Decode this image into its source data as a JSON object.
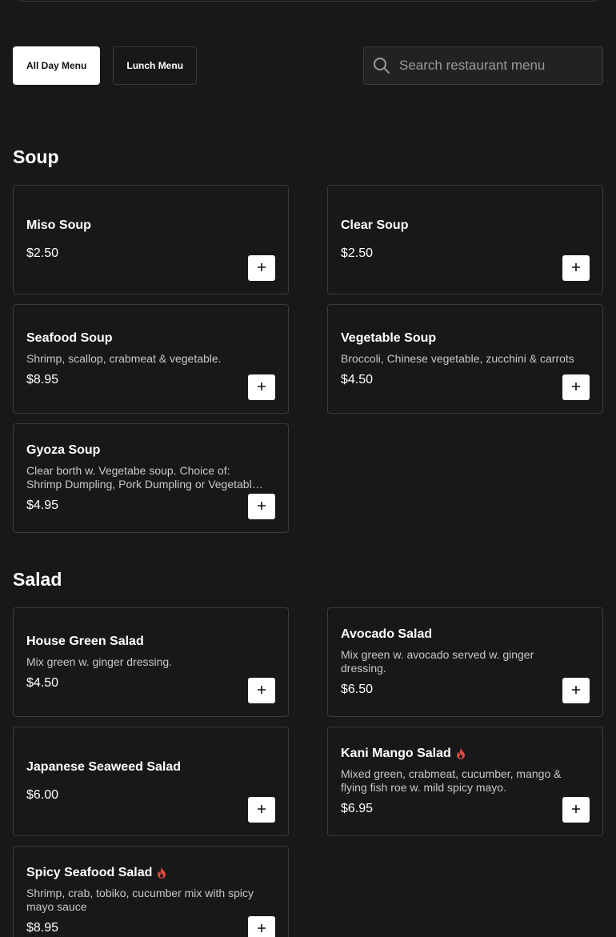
{
  "tabs": [
    {
      "label": "All Day Menu",
      "active": true
    },
    {
      "label": "Lunch Menu",
      "active": false
    }
  ],
  "search": {
    "placeholder": "Search restaurant menu",
    "value": ""
  },
  "colors": {
    "background": "#181818",
    "card_border": "#3a3a3a",
    "spicy": "#e04a3f",
    "button": "#ffffff"
  },
  "sections": [
    {
      "title": "Soup",
      "items": [
        {
          "name": "Miso Soup",
          "description": "",
          "price": "$2.50",
          "spicy": false
        },
        {
          "name": "Clear Soup",
          "description": "",
          "price": "$2.50",
          "spicy": false
        },
        {
          "name": "Seafood Soup",
          "description": "Shrimp, scallop, crabmeat & vegetable.",
          "price": "$8.95",
          "spicy": false
        },
        {
          "name": "Vegetable Soup",
          "description": "Broccoli, Chinese vegetable, zucchini & carrots",
          "price": "$4.50",
          "spicy": false
        },
        {
          "name": "Gyoza Soup",
          "description": "Clear borth w. Vegetabe soup. Choice of: Shrimp Dumpling, Pork Dumpling or Vegetable Dumpling",
          "price": "$4.95",
          "spicy": false
        }
      ]
    },
    {
      "title": "Salad",
      "items": [
        {
          "name": "House Green Salad",
          "description": "Mix green w. ginger dressing.",
          "price": "$4.50",
          "spicy": false
        },
        {
          "name": "Avocado Salad",
          "description": "Mix green w. avocado served w. ginger dressing.",
          "price": "$6.50",
          "spicy": false
        },
        {
          "name": "Japanese Seaweed Salad",
          "description": "",
          "price": "$6.00",
          "spicy": false
        },
        {
          "name": "Kani Mango Salad",
          "description": "Mixed green, crabmeat, cucumber, mango & flying fish roe w. mild spicy mayo.",
          "price": "$6.95",
          "spicy": true
        },
        {
          "name": "Spicy Seafood Salad",
          "description": "Shrimp, crab, tobiko, cucumber mix with spicy mayo sauce",
          "price": "$8.95",
          "spicy": true
        }
      ]
    }
  ]
}
